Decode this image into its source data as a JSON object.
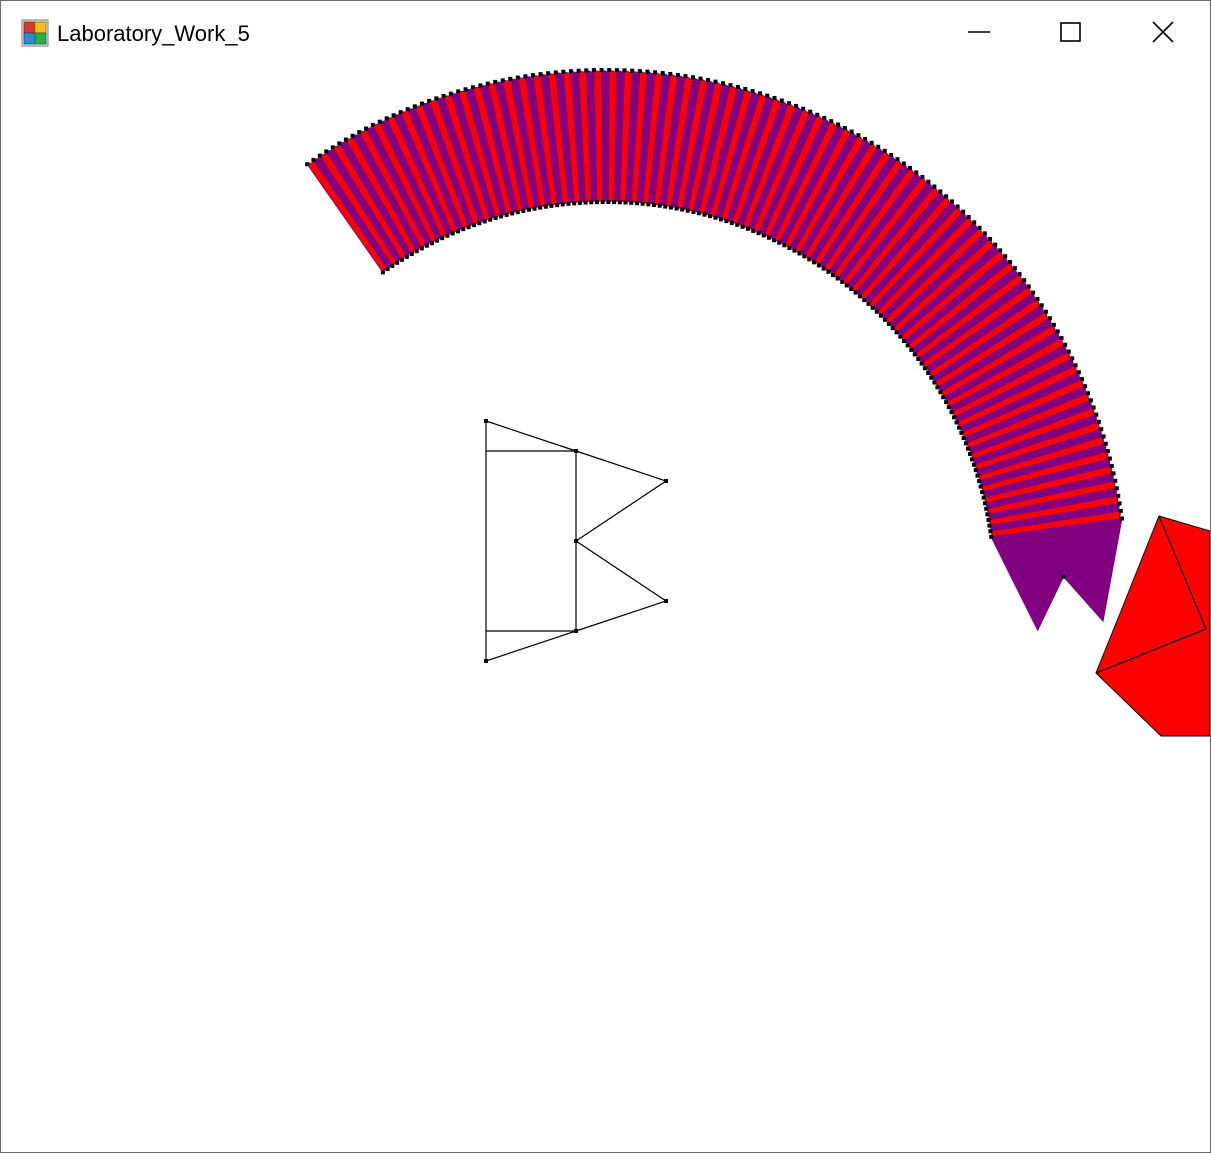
{
  "window": {
    "title": "Laboratory_Work_5"
  },
  "titlebar": {
    "icons": {
      "app": "app-form-icon",
      "minimize": "minimize-icon",
      "maximize": "maximize-icon",
      "close": "close-icon"
    }
  },
  "canvas": {
    "colors": {
      "fill_primary": "#ff0000",
      "fill_secondary": "#800080",
      "outline": "#000000",
      "background": "#ffffff"
    },
    "trail_description_hidden": null
  }
}
